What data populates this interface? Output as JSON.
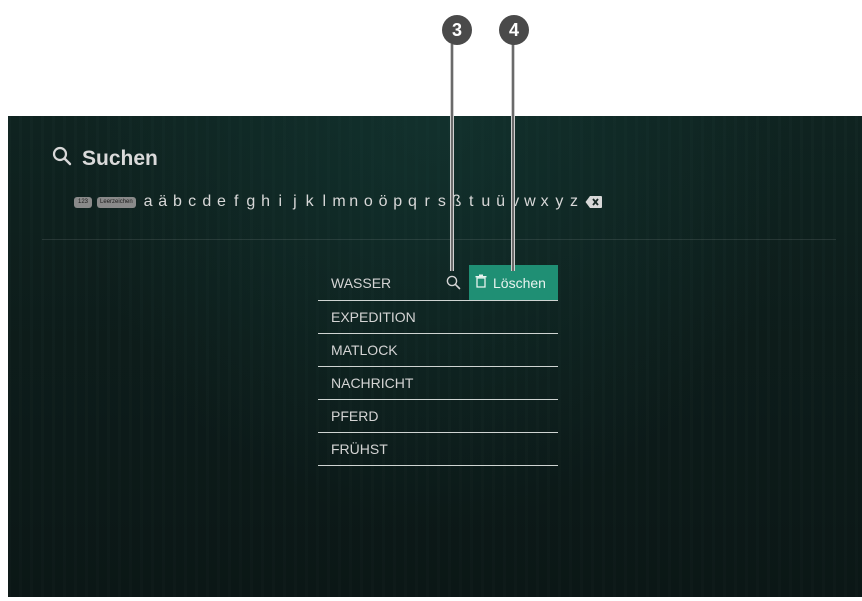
{
  "callouts": [
    {
      "label": "3"
    },
    {
      "label": "4"
    }
  ],
  "search": {
    "title": "Suchen"
  },
  "keyboard": {
    "numbers_key": "123",
    "space_key": "Leerzeichen",
    "letters": [
      "a",
      "ä",
      "b",
      "c",
      "d",
      "e",
      "f",
      "g",
      "h",
      "i",
      "j",
      "k",
      "l",
      "m",
      "n",
      "o",
      "ö",
      "p",
      "q",
      "r",
      "s",
      "ß",
      "t",
      "u",
      "ü",
      "v",
      "w",
      "x",
      "y",
      "z"
    ]
  },
  "history": {
    "items": [
      {
        "label": "WASSER"
      },
      {
        "label": "EXPEDITION"
      },
      {
        "label": "MATLOCK"
      },
      {
        "label": "NACHRICHT"
      },
      {
        "label": "PFERD"
      },
      {
        "label": "FRÜHST"
      }
    ],
    "delete_label": "Löschen"
  },
  "colors": {
    "accent": "#1f8f74",
    "callout": "#4a4a4a",
    "background": "#0d1d1b"
  }
}
